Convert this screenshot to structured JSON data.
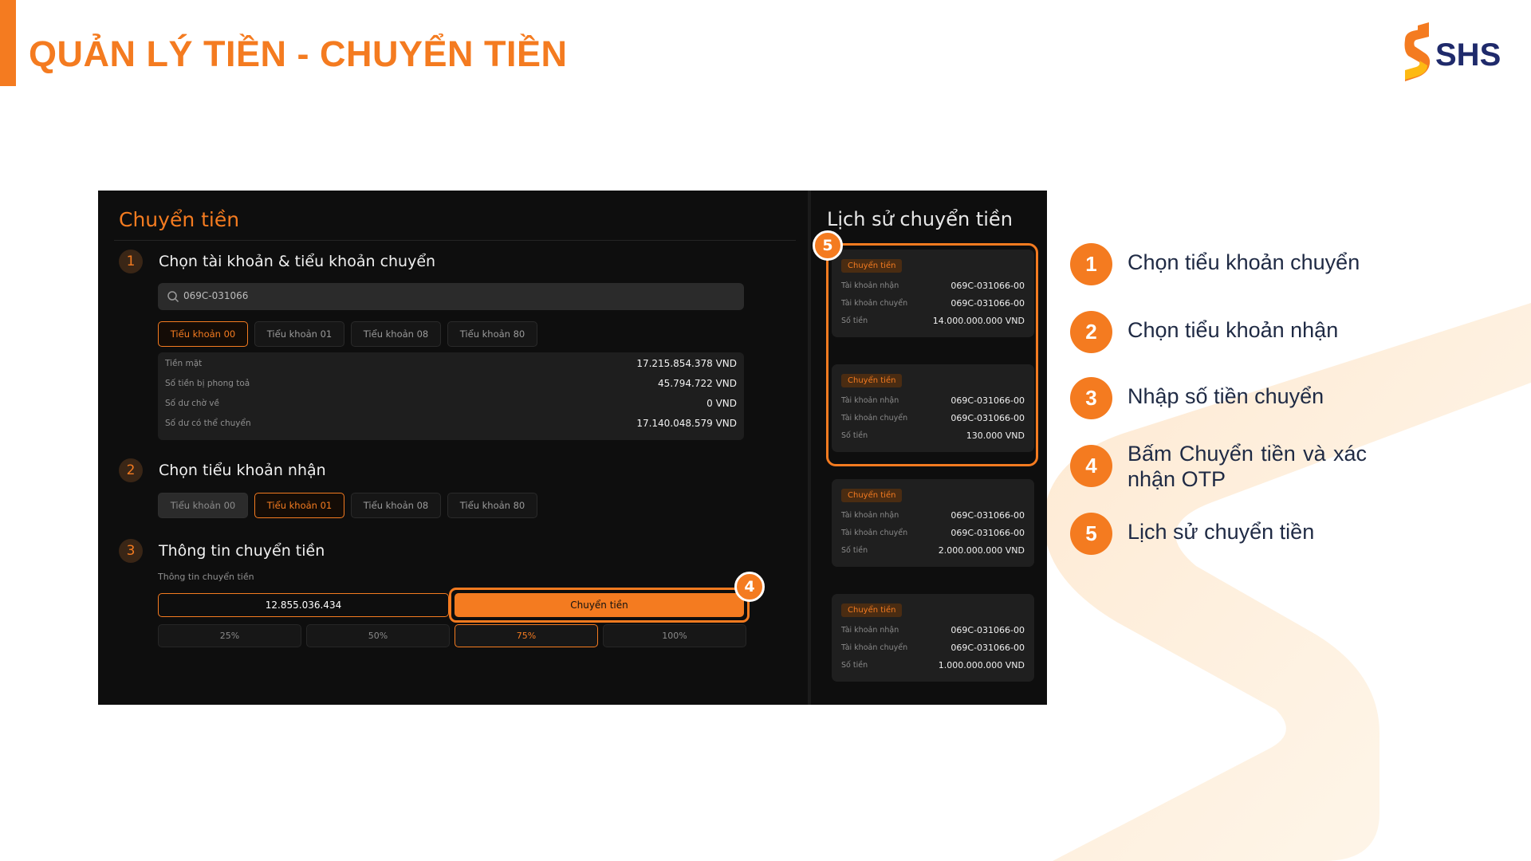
{
  "slide": {
    "title": "QUẢN LÝ TIỀN - CHUYỂN TIỀN",
    "brand": "SHS",
    "accent_color": "#F47B20"
  },
  "app": {
    "transfer_panel": {
      "title": "Chuyển tiền",
      "step1": {
        "number": "1",
        "title": "Chọn tài khoản & tiểu khoản chuyển",
        "search_value": "069C-031066",
        "search_icon": "search-icon",
        "tabs": [
          "Tiểu khoản 00",
          "Tiểu khoản 01",
          "Tiểu khoản 08",
          "Tiểu khoản 80"
        ],
        "selected_tab": "Tiểu khoản 00",
        "balances": [
          {
            "label": "Tiền mặt",
            "value": "17.215.854.378 VND"
          },
          {
            "label": "Số tiền bị phong toả",
            "value": "45.794.722 VND"
          },
          {
            "label": "Số dư chờ về",
            "value": "0 VND"
          },
          {
            "label": "Số dư có thể chuyển",
            "value": "17.140.048.579 VND"
          }
        ]
      },
      "step2": {
        "number": "2",
        "title": "Chọn tiểu khoản nhận",
        "tabs": [
          "Tiểu khoản 00",
          "Tiểu khoản 01",
          "Tiểu khoản 08",
          "Tiểu khoản 80"
        ],
        "selected_tab": "Tiểu khoản 01"
      },
      "step3": {
        "number": "3",
        "title": "Thông tin chuyển tiền",
        "field_label": "Thông tin chuyển tiền",
        "amount": "12.855.036.434",
        "submit_label": "Chuyển tiền",
        "percent_options": [
          "25%",
          "50%",
          "75%",
          "100%"
        ],
        "selected_percent": "75%"
      }
    },
    "history_panel": {
      "title": "Lịch sử chuyển tiền",
      "items": [
        {
          "tag": "Chuyển tiền",
          "receive_label": "Tài khoản nhận",
          "receive": "069C-031066-00",
          "send_label": "Tài khoản chuyển",
          "send": "069C-031066-00",
          "amount_label": "Số tiền",
          "amount": "14.000.000.000 VND"
        },
        {
          "tag": "Chuyển tiền",
          "receive_label": "Tài khoản nhận",
          "receive": "069C-031066-00",
          "send_label": "Tài khoản chuyển",
          "send": "069C-031066-00",
          "amount_label": "Số tiền",
          "amount": "130.000 VND"
        },
        {
          "tag": "Chuyển tiền",
          "receive_label": "Tài khoản nhận",
          "receive": "069C-031066-00",
          "send_label": "Tài khoản chuyển",
          "send": "069C-031066-00",
          "amount_label": "Số tiền",
          "amount": "2.000.000.000 VND"
        },
        {
          "tag": "Chuyển tiền",
          "receive_label": "Tài khoản nhận",
          "receive": "069C-031066-00",
          "send_label": "Tài khoản chuyển",
          "send": "069C-031066-00",
          "amount_label": "Số tiền",
          "amount": "1.000.000.000 VND"
        }
      ]
    },
    "callouts": {
      "transfer_button": "4",
      "history": "5"
    }
  },
  "legend": [
    {
      "number": "1",
      "text": "Chọn tiểu khoản chuyển"
    },
    {
      "number": "2",
      "text": "Chọn tiểu khoản nhận"
    },
    {
      "number": "3",
      "text": "Nhập số tiền chuyển"
    },
    {
      "number": "4",
      "text": "Bấm Chuyển tiền và xác nhận OTP"
    },
    {
      "number": "5",
      "text": "Lịch sử chuyển tiền"
    }
  ]
}
